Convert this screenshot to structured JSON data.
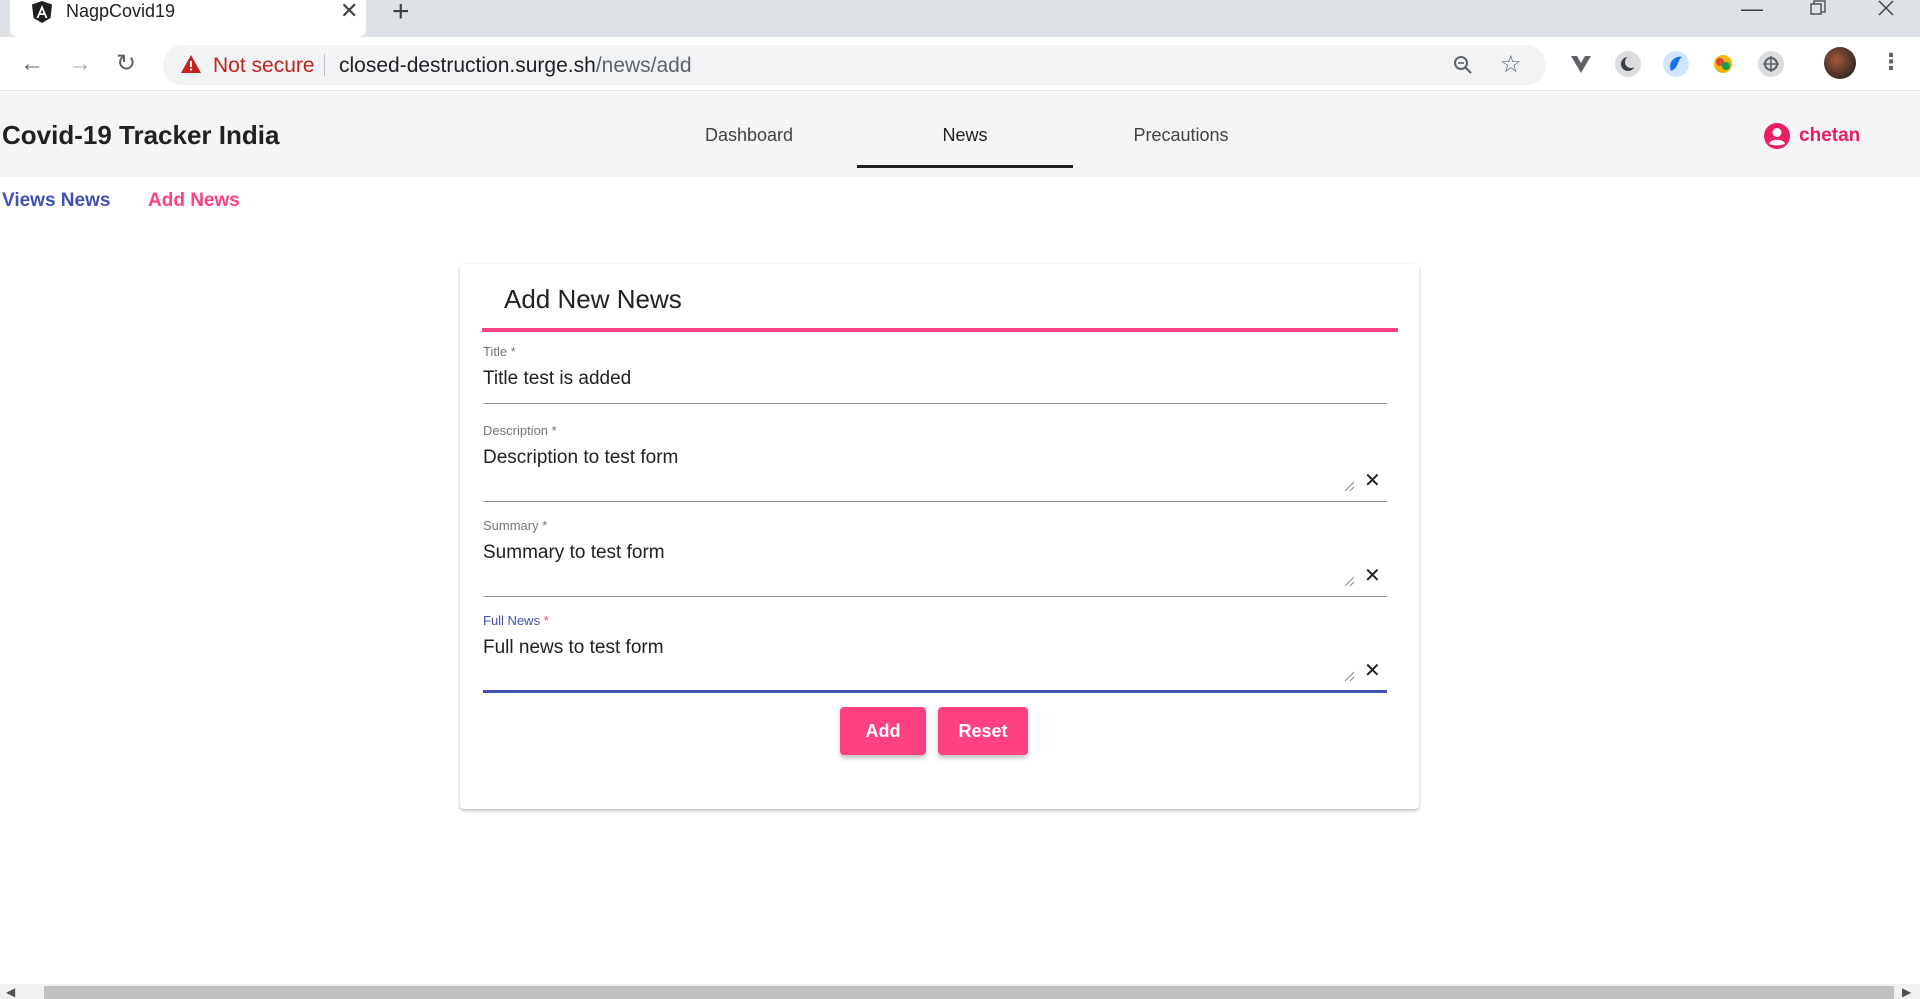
{
  "browser": {
    "tab_title": "NagpCovid19",
    "new_tab": "+",
    "tab_close": "✕",
    "security_label": "Not secure",
    "url_host": "closed-destruction.surge.sh",
    "url_path": "/news/add"
  },
  "header": {
    "brand": "Covid-19 Tracker India",
    "nav": [
      {
        "label": "Dashboard"
      },
      {
        "label": "News",
        "active": true
      },
      {
        "label": "Precautions"
      }
    ],
    "user": "chetan"
  },
  "subnav": {
    "view_news": "Views News",
    "add_news": "Add News"
  },
  "form": {
    "title": "Add New News",
    "fields": [
      {
        "label": "Title",
        "value": "Title test is added"
      },
      {
        "label": "Description",
        "value": "Description to test form"
      },
      {
        "label": "Summary",
        "value": "Summary to test form"
      },
      {
        "label": "Full News",
        "value": "Full news to test form"
      }
    ],
    "required_marker": "*",
    "add_button": "Add",
    "reset_button": "Reset"
  },
  "colors": {
    "accent": "#ff4081",
    "primary": "#3f51b5",
    "user": "#e91e63"
  }
}
